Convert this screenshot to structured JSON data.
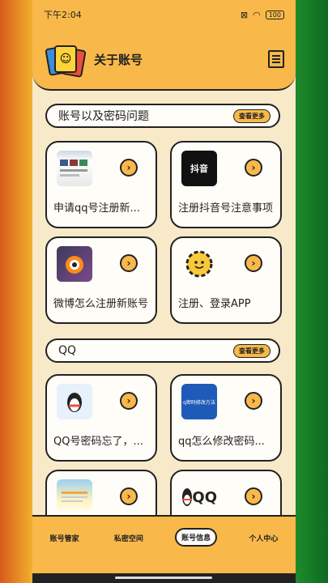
{
  "status": {
    "time": "下午2:04",
    "battery": "100"
  },
  "header": {
    "title": "关于账号"
  },
  "sections": [
    {
      "label": "账号以及密码问题",
      "more": "查看更多"
    },
    {
      "label": "QQ",
      "more": "查看更多"
    }
  ],
  "cards": [
    {
      "label": "申请qq号注册新...",
      "icon": "browser-screenshot"
    },
    {
      "label": "注册抖音号注意事项",
      "icon": "douyin-logo",
      "thumb_text": "抖音"
    },
    {
      "label": "微博怎么注册新账号",
      "icon": "weibo-logo"
    },
    {
      "label": "注册、登录APP",
      "icon": "gear-smiley"
    },
    {
      "label": "QQ号密码忘了，...",
      "icon": "qq-penguin"
    },
    {
      "label": "qq怎么修改密码...",
      "icon": "qq-password-banner",
      "thumb_text": "q密码修改方法"
    },
    {
      "label": "",
      "icon": "qq-app-screenshot"
    },
    {
      "label": "",
      "icon": "qq-logo",
      "thumb_text": "QQ"
    }
  ],
  "tabs": [
    "账号管家",
    "私密空间",
    "账号信息",
    "个人中心"
  ],
  "colors": {
    "accent": "#f8b94a",
    "card_bg": "#fffdf8",
    "page_bg": "#f8e9c9",
    "outline": "#222222"
  }
}
